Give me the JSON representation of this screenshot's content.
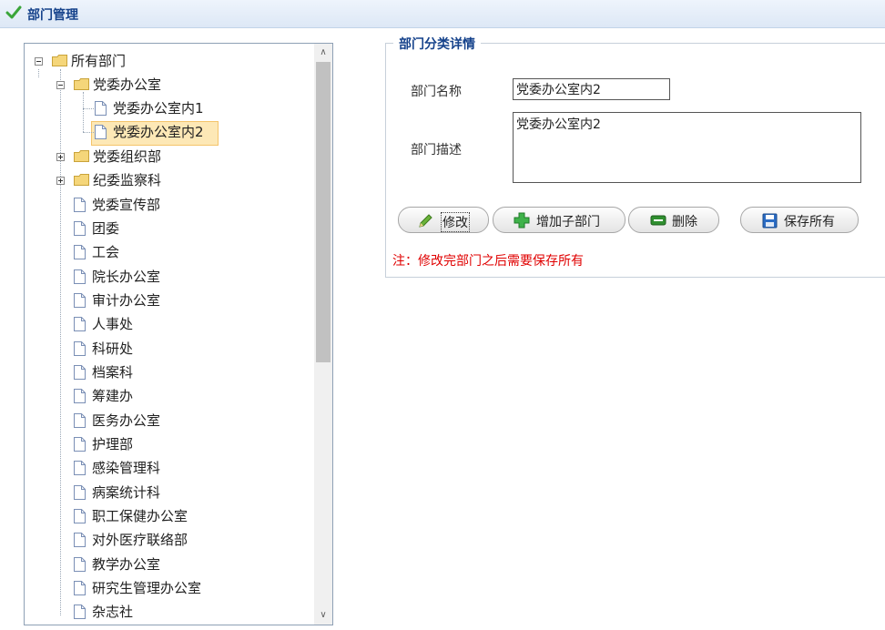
{
  "header": {
    "title": "部门管理"
  },
  "tree": {
    "root": "所有部门",
    "nodes": [
      "党委办公室",
      "党委办公室内1",
      "党委办公室内2",
      "党委组织部",
      "纪委监察科",
      "党委宣传部",
      "团委",
      "工会",
      "院长办公室",
      "审计办公室",
      "人事处",
      "科研处",
      "档案科",
      "筹建办",
      "医务办公室",
      "护理部",
      "感染管理科",
      "病案统计科",
      "职工保健办公室",
      "对外医疗联络部",
      "教学办公室",
      "研究生管理办公室",
      "杂志社"
    ],
    "selected": "党委办公室内2"
  },
  "detail": {
    "legend": "部门分类详情",
    "name_label": "部门名称",
    "name_value": "党委办公室内2",
    "desc_label": "部门描述",
    "desc_value": "党委办公室内2",
    "buttons": {
      "edit": "修改",
      "add_child": "增加子部门",
      "delete": "删除",
      "save_all": "保存所有"
    },
    "note": "注：修改完部门之后需要保存所有"
  },
  "colors": {
    "accent": "#15428b",
    "note": "#e00000",
    "selected": "#fde8b6"
  }
}
